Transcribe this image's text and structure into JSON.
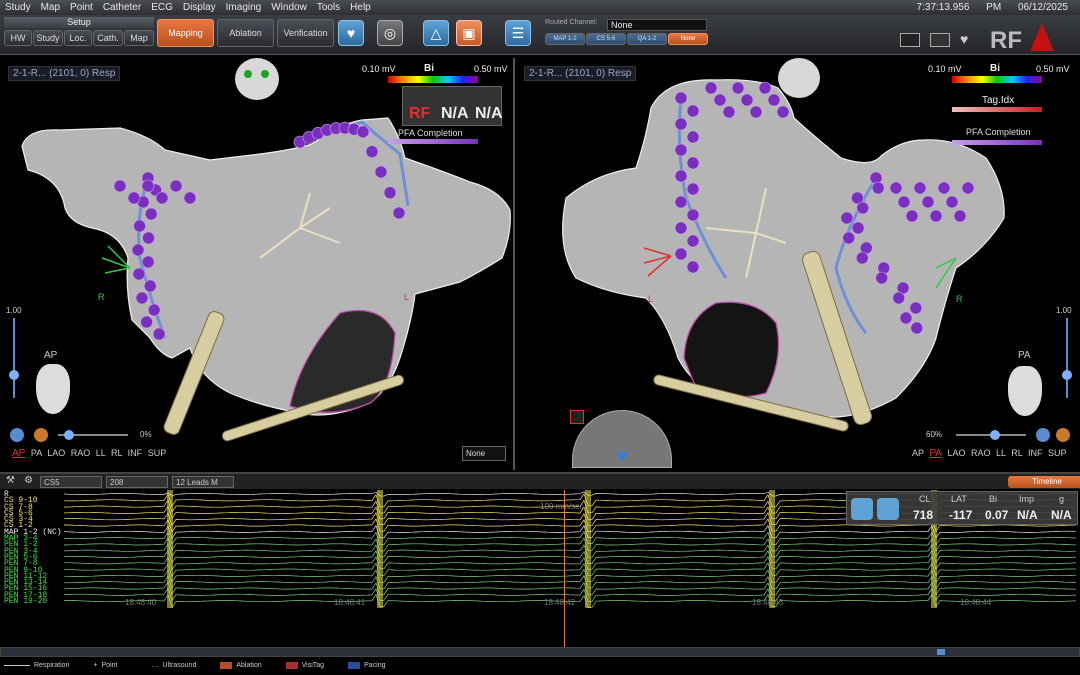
{
  "menu": {
    "items": [
      "Study",
      "Map",
      "Point",
      "Catheter",
      "ECG",
      "Display",
      "Imaging",
      "Window",
      "Tools",
      "Help"
    ],
    "time": "7:37:13.956 PM",
    "date": "06/12/2025"
  },
  "toolbar": {
    "setup_label": "Setup",
    "setup_tabs": [
      "HW",
      "Study",
      "Loc.",
      "Cath.",
      "Map"
    ],
    "mapping": "Mapping",
    "ablation": "Ablation",
    "verification": "Verification",
    "routed_channel_label": "Routed Channel:",
    "routed_channel_value": "None",
    "channel_buttons": [
      "MAP 1-2",
      "CS 5-6",
      "QA 1-2",
      "None"
    ],
    "brand": "RF"
  },
  "left_view": {
    "map_name": "2-1-R... (2101, 0) Resp",
    "scale_min": "0.10 mV",
    "scale_type": "Bi",
    "scale_max": "0.50 mV",
    "rf_label": "RF",
    "na1": "N/A",
    "na2": "N/A",
    "pfa_label": "PFA Completion",
    "scale_top": "1.00",
    "orientation": "AP",
    "dir_R": "R",
    "dir_L": "L",
    "zoom": "0%",
    "views": [
      "AP",
      "PA",
      "LAO",
      "RAO",
      "LL",
      "RL",
      "INF",
      "SUP"
    ],
    "none_dropdown": "None"
  },
  "right_view": {
    "map_name": "2-1-R... (2101, 0) Resp",
    "scale_min": "0.10 mV",
    "scale_type": "Bi",
    "scale_max": "0.50 mV",
    "tag_label": "Tag.Idx",
    "pfa_label": "PFA Completion",
    "scale_top": "1.00",
    "orientation": "PA",
    "dir_R": "R",
    "dir_L": "L",
    "zoom": "60%",
    "views": [
      "AP",
      "PA",
      "LAO",
      "RAO",
      "LL",
      "RL",
      "INF",
      "SUP"
    ]
  },
  "ecg": {
    "source": "CS5",
    "speed": "208",
    "leads": "12 Leads M",
    "sweep": "100 mm/sec",
    "timeline": "Timeline",
    "channels": [
      "R",
      "CS 9-10",
      "CS 7-8",
      "CS 5-6",
      "CS 3-4",
      "CS 1-2",
      "MAP 1-2 (NC)",
      "MAP 3-4",
      "PEN 1-2",
      "PEN 3-4",
      "PEN 5-6",
      "PEN 7-8",
      "PEN 9-10",
      "PEN 11-12",
      "PEN 13-14",
      "PEN 15-16",
      "PEN 17-18",
      "PEN 19-20"
    ],
    "times": [
      "18:48:40",
      "18:48:41",
      "18:48:42",
      "18:48:43",
      "18:48:44"
    ],
    "metrics": {
      "headers": [
        "CL",
        "LAT",
        "Bi",
        "Imp",
        "g"
      ],
      "values": [
        "718",
        "-117",
        "0.07",
        "N/A",
        "N/A"
      ]
    }
  },
  "legend": [
    "Respiration",
    "Point",
    "Ultrasound",
    "Ablation",
    "VisiTag",
    "Pacing"
  ],
  "colors": {
    "accent": "#e8773f",
    "point": "#7b2fbf",
    "scale_start": "#cc0000",
    "scale_end": "#990099"
  }
}
